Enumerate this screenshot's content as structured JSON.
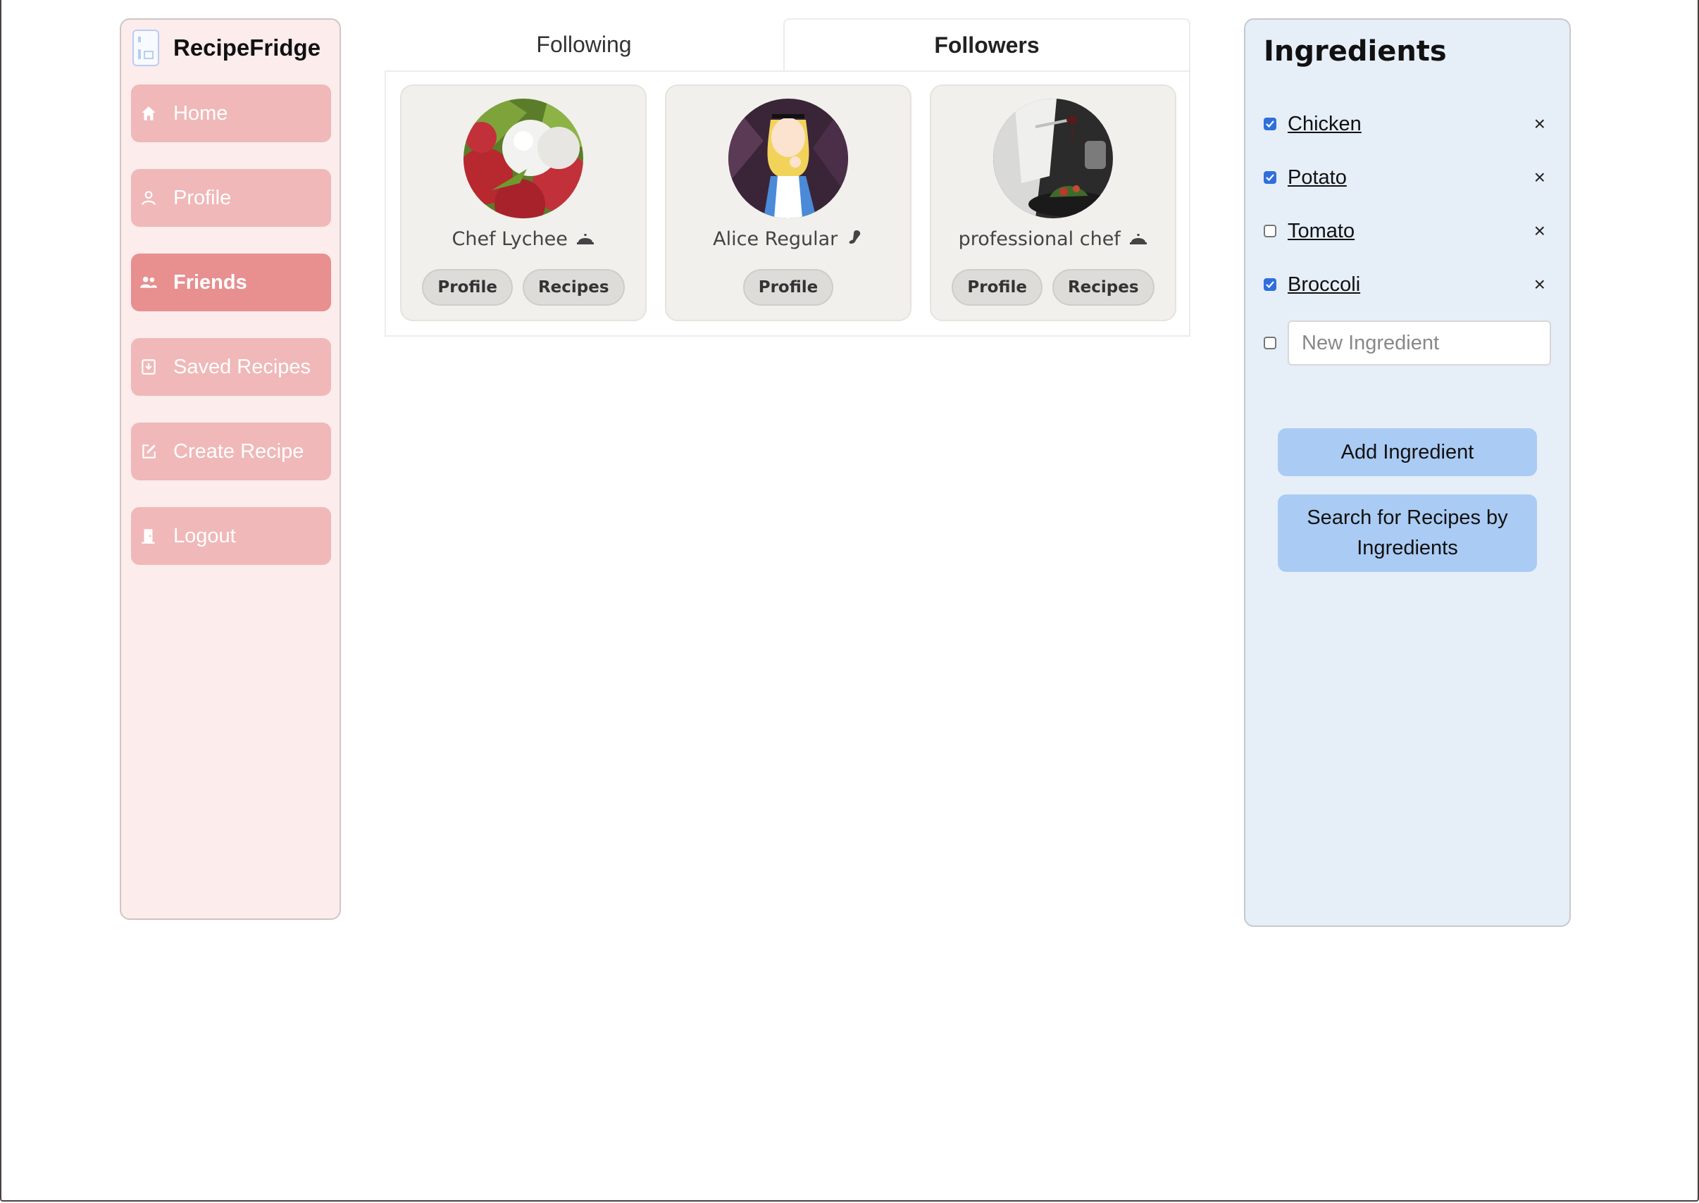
{
  "app": {
    "name": "RecipeFridge"
  },
  "sidebar": {
    "items": [
      {
        "label": "Home",
        "icon": "home-icon"
      },
      {
        "label": "Profile",
        "icon": "user-icon"
      },
      {
        "label": "Friends",
        "icon": "users-icon",
        "active": true
      },
      {
        "label": "Saved Recipes",
        "icon": "bookmark-download-icon"
      },
      {
        "label": "Create Recipe",
        "icon": "edit-icon"
      },
      {
        "label": "Logout",
        "icon": "door-icon"
      }
    ]
  },
  "tabs": [
    {
      "label": "Following",
      "active": false
    },
    {
      "label": "Followers",
      "active": true
    }
  ],
  "followers": [
    {
      "name": "Chef Lychee",
      "role_icon": "chef-bell-icon",
      "avatar": "lychee-photo",
      "buttons": [
        "Profile",
        "Recipes"
      ]
    },
    {
      "name": "Alice Regular",
      "role_icon": "leg-icon",
      "avatar": "alice-cartoon",
      "buttons": [
        "Profile"
      ]
    },
    {
      "name": "professional chef",
      "role_icon": "chef-bell-icon",
      "avatar": "chef-plating-photo",
      "buttons": [
        "Profile",
        "Recipes"
      ]
    }
  ],
  "ingredients": {
    "title": "Ingredients",
    "items": [
      {
        "name": "Chicken",
        "checked": true
      },
      {
        "name": "Potato",
        "checked": true
      },
      {
        "name": "Tomato",
        "checked": false
      },
      {
        "name": "Broccoli",
        "checked": true
      }
    ],
    "remove_glyph": "×",
    "new_placeholder": "New Ingredient",
    "add_button": "Add Ingredient",
    "search_button": "Search for Recipes by Ingredients"
  },
  "colors": {
    "sidebar_bg": "#fcecec",
    "nav_item": "#f0b8b8",
    "nav_active": "#e88f8f",
    "ingredients_bg": "#e6eef8",
    "button_blue": "#aacbf3",
    "checkbox_blue": "#2f6fdc"
  }
}
